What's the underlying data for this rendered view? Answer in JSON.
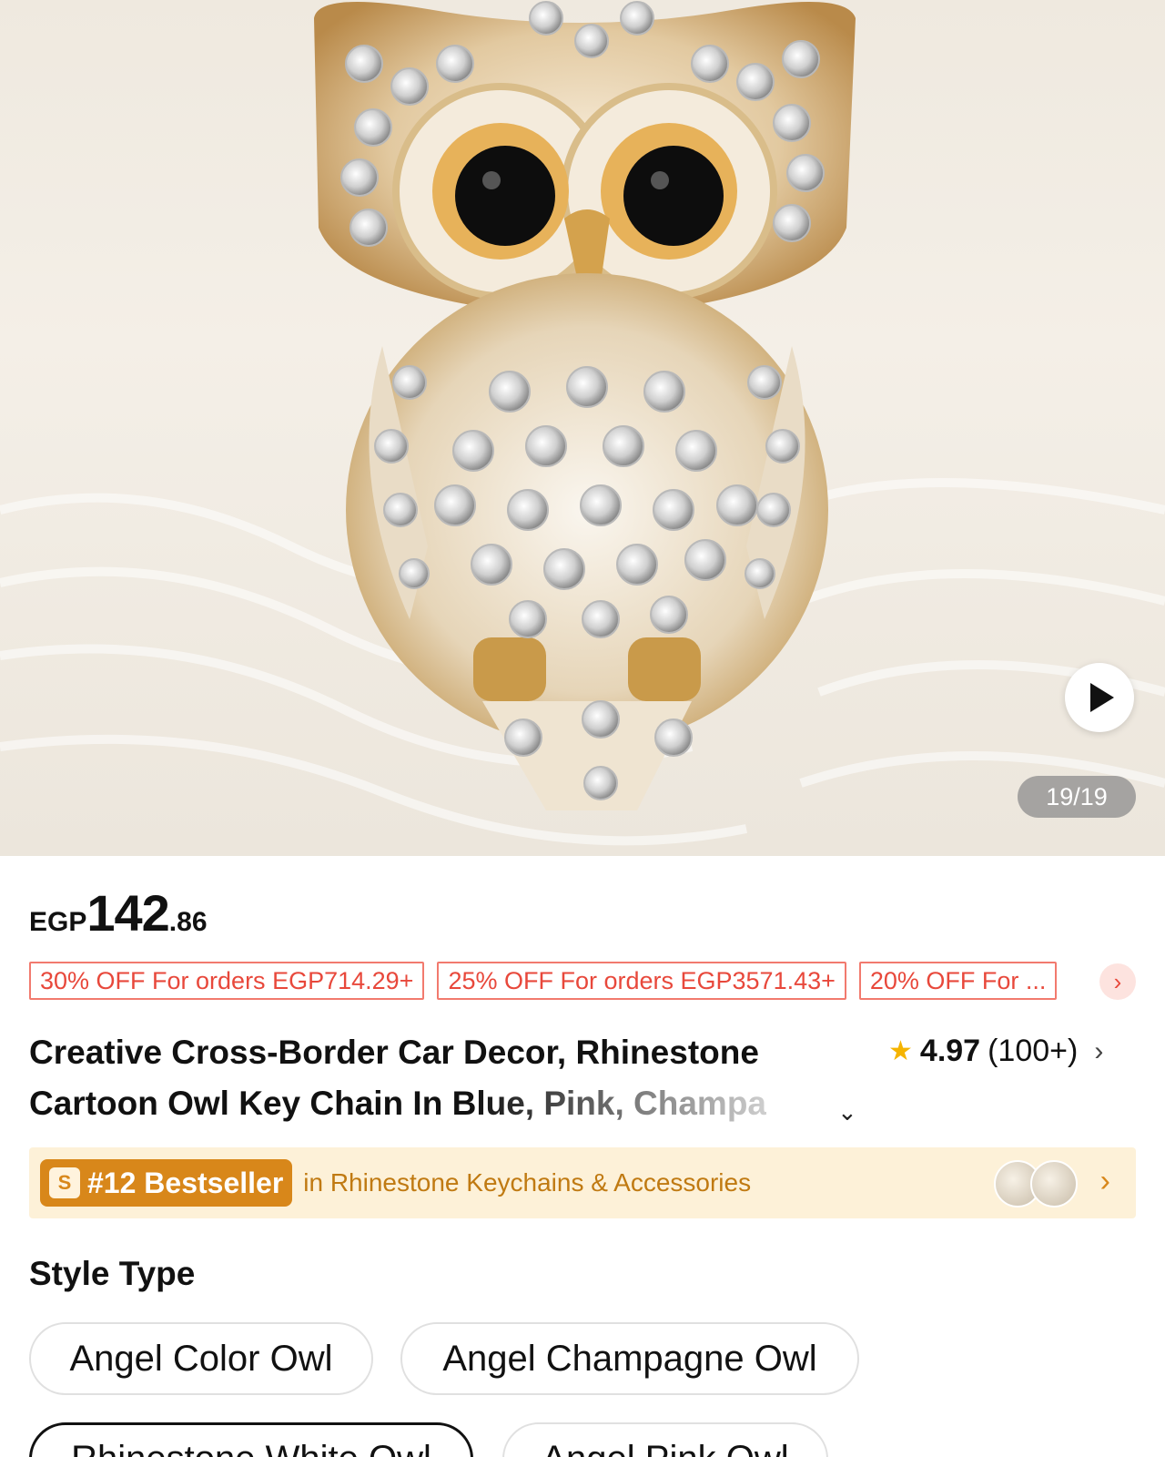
{
  "gallery": {
    "counter": "19/19",
    "image_icon": "owl-keychain-photo",
    "play_icon": "play-icon"
  },
  "price": {
    "currency": "EGP",
    "integer": "142",
    "decimal": ".86"
  },
  "coupons": [
    "30% OFF For orders EGP714.29+",
    "25% OFF For orders EGP3571.43+",
    "20% OFF For ..."
  ],
  "title": {
    "line1": "Creative Cross-Border Car Decor, Rhinestone",
    "line2": "Cartoon Owl Key Chain In Blue, Pink, Champa"
  },
  "rating": {
    "score": "4.97",
    "count": "(100+)"
  },
  "bestseller": {
    "badge": "#12 Bestseller",
    "category": "in Rhinestone Keychains & Accessories"
  },
  "style": {
    "label": "Style Type",
    "options": [
      "Angel Color Owl",
      "Angel Champagne Owl",
      "Rhinestone White Owl",
      "Angel Pink Owl"
    ],
    "selected": "Rhinestone White Owl"
  },
  "colors": {
    "coupon_red": "#e8483b",
    "bestseller_orange": "#d8871a",
    "bestseller_bg": "#fdf1d8",
    "star": "#f5b400"
  }
}
